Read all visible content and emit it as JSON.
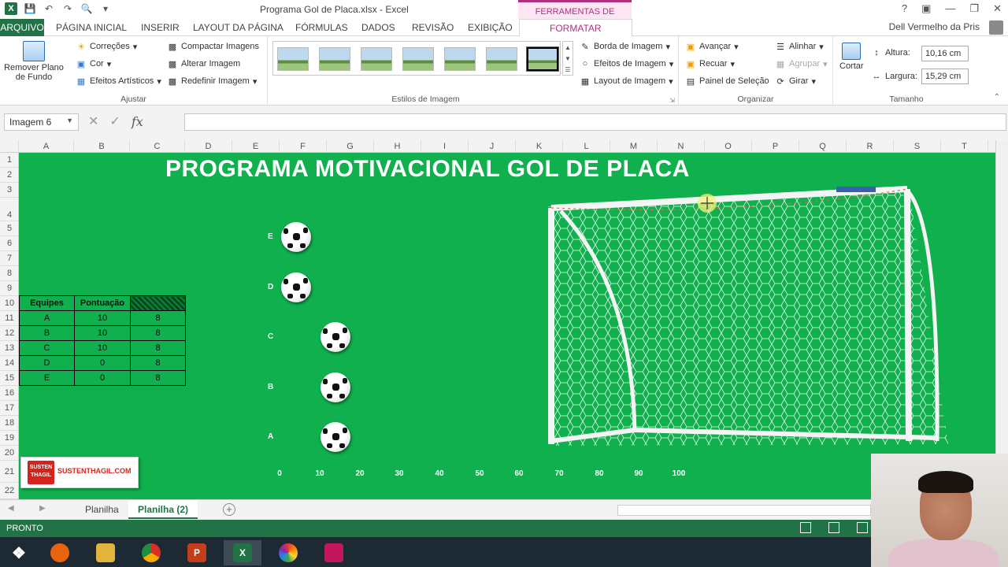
{
  "window": {
    "title": "Programa Gol de Placa.xlsx - Excel",
    "context_tab_title": "FERRAMENTAS DE IMAGEM",
    "user": "Dell Vermelho da Pris"
  },
  "ribbon_tabs": {
    "file": "ARQUIVO",
    "items": [
      "PÁGINA INICIAL",
      "INSERIR",
      "LAYOUT DA PÁGINA",
      "FÓRMULAS",
      "DADOS",
      "REVISÃO",
      "EXIBIÇÃO"
    ],
    "active": "FORMATAR"
  },
  "ribbon": {
    "ajustar": {
      "label": "Ajustar",
      "remove_bg": "Remover Plano de Fundo",
      "correcoes": "Correções",
      "cor": "Cor",
      "efeitos_artisticos": "Efeitos Artísticos",
      "compactar": "Compactar Imagens",
      "alterar": "Alterar Imagem",
      "redefinir": "Redefinir Imagem"
    },
    "estilos": {
      "label": "Estilos de Imagem",
      "borda": "Borda de Imagem",
      "efeitos": "Efeitos de Imagem",
      "layout": "Layout de Imagem"
    },
    "organizar": {
      "label": "Organizar",
      "avancar": "Avançar",
      "recuar": "Recuar",
      "painel": "Painel de Seleção",
      "alinhar": "Alinhar",
      "agrupar": "Agrupar",
      "girar": "Girar"
    },
    "tamanho": {
      "label": "Tamanho",
      "cortar": "Cortar",
      "altura_label": "Altura:",
      "altura": "10,16 cm",
      "largura_label": "Largura:",
      "largura": "15,29 cm"
    }
  },
  "formula_bar": {
    "name_box": "Imagem 6",
    "fx": "fx",
    "formula": ""
  },
  "columns": [
    "A",
    "B",
    "C",
    "D",
    "E",
    "F",
    "G",
    "H",
    "I",
    "J",
    "K",
    "L",
    "M",
    "N",
    "O",
    "P",
    "Q",
    "R",
    "S",
    "T"
  ],
  "rows": [
    "1",
    "2",
    "3",
    "4",
    "5",
    "6",
    "7",
    "8",
    "9",
    "10",
    "11",
    "12",
    "13",
    "14",
    "15",
    "16",
    "17",
    "18",
    "19",
    "20",
    "21",
    "22"
  ],
  "sheet": {
    "title": "PROGRAMA MOTIVACIONAL GOL DE PLACA",
    "table_headers": [
      "Equipes",
      "Pontuação",
      ""
    ],
    "table_rows": [
      [
        "A",
        "10",
        "8"
      ],
      [
        "B",
        "10",
        "8"
      ],
      [
        "C",
        "10",
        "8"
      ],
      [
        "D",
        "0",
        "8"
      ],
      [
        "E",
        "0",
        "8"
      ]
    ],
    "ball_labels": [
      "E",
      "D",
      "C",
      "B",
      "A"
    ],
    "axis_ticks": [
      "0",
      "10",
      "20",
      "30",
      "40",
      "50",
      "60",
      "70",
      "80",
      "90",
      "100"
    ],
    "logo_badge": "SUSTEN THAGIL",
    "logo_text": "SUSTENTHAGIL.COM"
  },
  "sheet_tabs": {
    "tabs": [
      "Planilha",
      "Planilha (2)"
    ],
    "active": "Planilha (2)"
  },
  "status": {
    "text": "PRONTO"
  },
  "colors": {
    "excel_green": "#217346",
    "sheet_bg": "#0fb04d",
    "context_pink": "#b03080"
  }
}
